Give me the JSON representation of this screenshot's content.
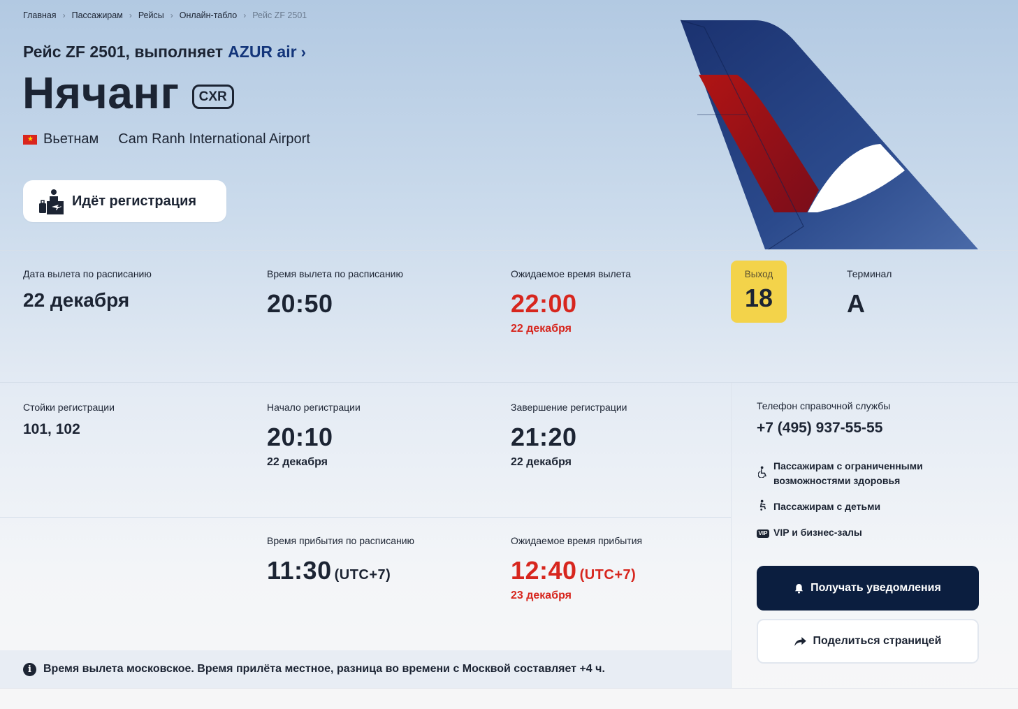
{
  "breadcrumb": [
    {
      "label": "Главная"
    },
    {
      "label": "Пассажирам"
    },
    {
      "label": "Рейсы"
    },
    {
      "label": "Онлайн-табло"
    },
    {
      "label": "Рейс ZF 2501"
    }
  ],
  "breadcrumb_separator": "›",
  "flight": {
    "prefix": "Рейс ZF 2501, выполняет",
    "airline": "AZUR air",
    "airline_chevron": "›",
    "city": "Нячанг",
    "iata": "CXR",
    "country": "Вьетнам",
    "airport": "Cam Ranh International Airport",
    "status": "Идёт регистрация"
  },
  "departure": {
    "sched_date_label": "Дата вылета по расписанию",
    "sched_date": "22 декабря",
    "sched_time_label": "Время вылета по расписанию",
    "sched_time": "20:50",
    "expected_label": "Ожидаемое время вылета",
    "expected_time": "22:00",
    "expected_date": "22 декабря",
    "gate_label": "Выход",
    "gate": "18",
    "terminal_label": "Терминал",
    "terminal": "A"
  },
  "checkin": {
    "counters_label": "Стойки регистрации",
    "counters": "101, 102",
    "start_label": "Начало регистрации",
    "start_time": "20:10",
    "start_date": "22 декабря",
    "end_label": "Завершение регистрации",
    "end_time": "21:20",
    "end_date": "22 декабря"
  },
  "arrival": {
    "sched_label": "Время прибытия по расписанию",
    "sched_time": "11:30",
    "sched_tz": "(UTC+7)",
    "expected_label": "Ожидаемое время прибытия",
    "expected_time": "12:40",
    "expected_tz": "(UTC+7)",
    "expected_date": "23 декабря"
  },
  "sidebar": {
    "phone_label": "Телефон справочной службы",
    "phone": "+7 (495) 937-55-55",
    "links": [
      {
        "label_line1": "Пассажирам с ограниченными",
        "label_line2": "возможностями здоровья",
        "icon": "wheelchair-icon"
      },
      {
        "label": "Пассажирам с детьми",
        "icon": "stroller-icon"
      },
      {
        "label": "VIP и бизнес-залы",
        "icon": "vip-icon",
        "badge": "VIP"
      }
    ],
    "notify_button": "Получать уведомления",
    "share_button": "Поделиться страницей"
  },
  "note": {
    "text": "Время вылета московское. Время прилёта местное, разница во времени с Москвой составляет +4 ч.",
    "icon_glyph": "i"
  },
  "colors": {
    "accent_red": "#d7261e",
    "gate_yellow": "#f3d34a",
    "primary_dark": "#0b1e3f",
    "airline_blue": "#13357a",
    "tail_blue": "#1f3a7a",
    "tail_red": "#c41a1a"
  }
}
